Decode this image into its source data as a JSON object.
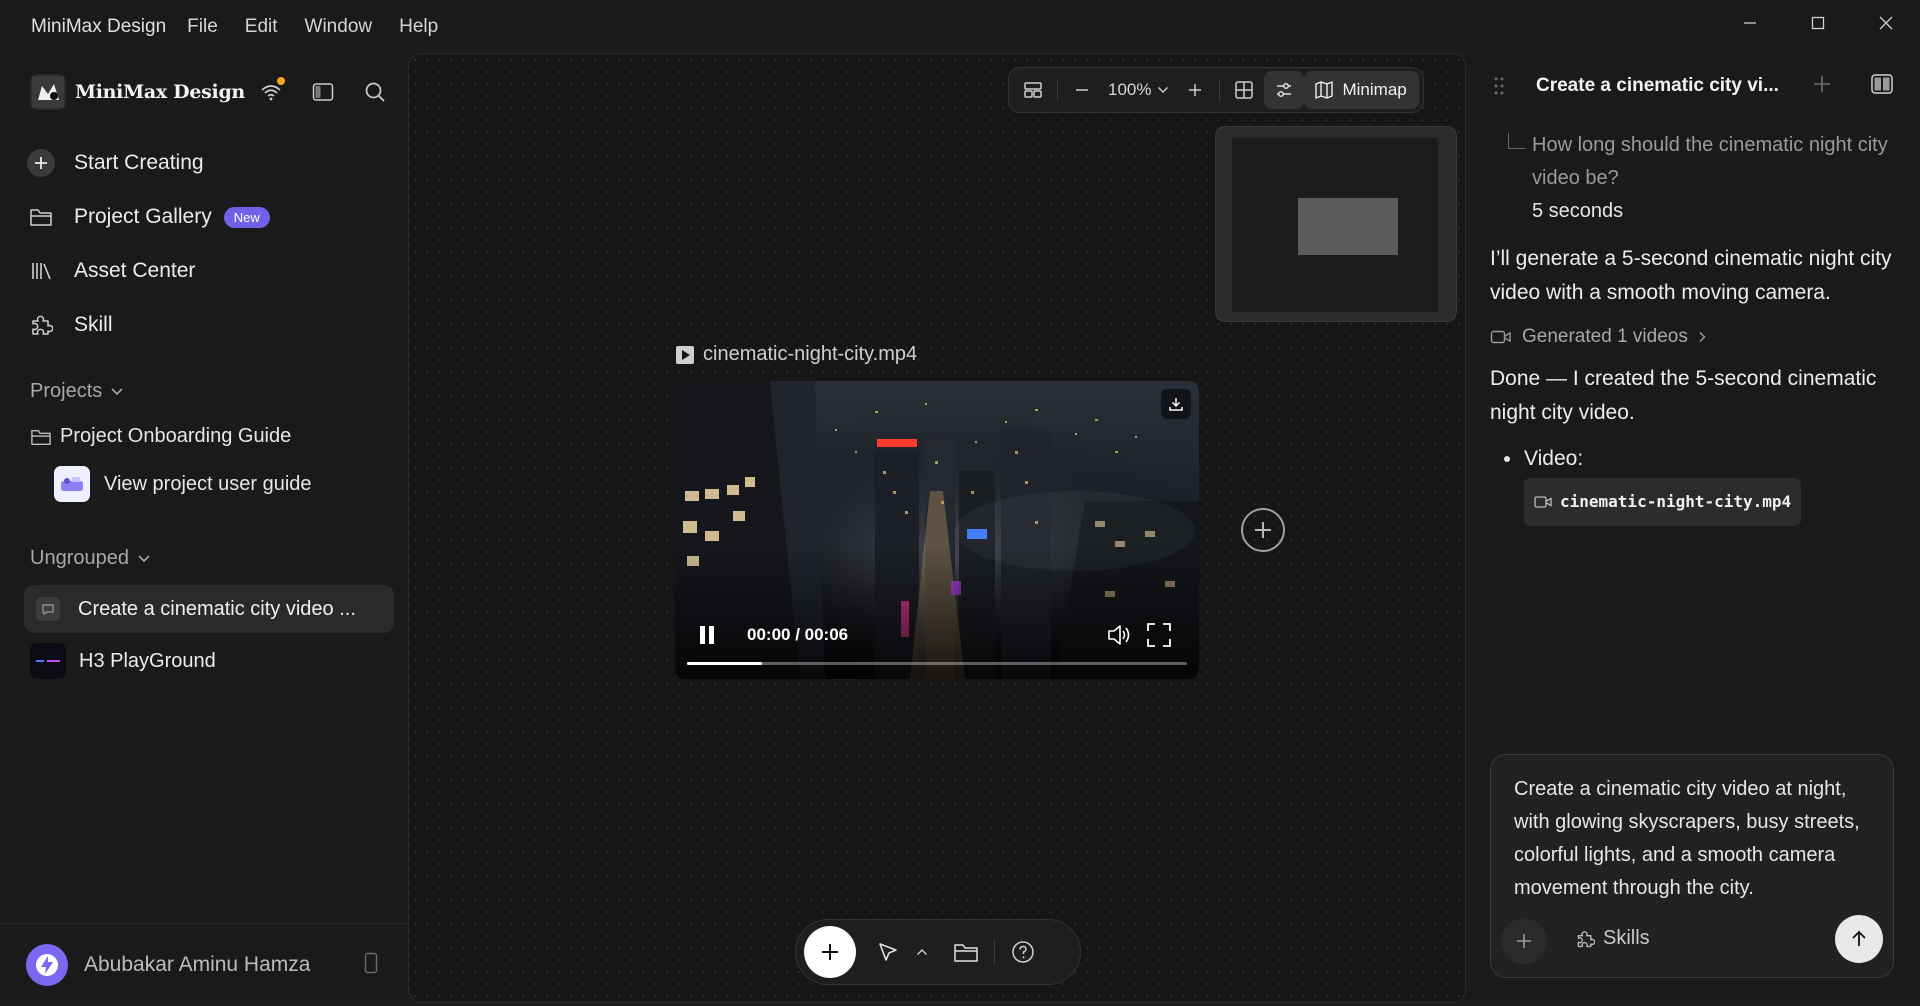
{
  "app": {
    "name": "MiniMax Design",
    "menu": [
      "File",
      "Edit",
      "Window",
      "Help"
    ]
  },
  "sidebar": {
    "brand": "MiniMax Design",
    "nav": [
      {
        "label": "Start Creating",
        "icon": "plus-circle-icon"
      },
      {
        "label": "Project Gallery",
        "icon": "folder-icon",
        "badge": "New"
      },
      {
        "label": "Asset Center",
        "icon": "library-icon"
      },
      {
        "label": "Skill",
        "icon": "puzzle-icon"
      }
    ],
    "projects_label": "Projects",
    "project_folder": "Project Onboarding Guide",
    "project_item": "View project user guide",
    "ungrouped_label": "Ungrouped",
    "chats": [
      {
        "label": "Create a cinematic city video ..."
      },
      {
        "label": "H3 PlayGround"
      }
    ],
    "user": "Abubakar Aminu Hamza",
    "colors": {
      "badge": "#6f62e8",
      "notification": "#f5a623",
      "avatar": "#7b68f0"
    }
  },
  "toolbar": {
    "zoom": "100%",
    "minimap_label": "Minimap"
  },
  "canvas": {
    "video_filename": "cinematic-night-city.mp4",
    "time": "00:00 / 00:06",
    "progress": 0.15
  },
  "panel": {
    "title": "Create a cinematic city vi...",
    "question": "How long should the cinematic night city video be?",
    "answer": "5 seconds",
    "message1": "I’ll generate a 5-second cinematic night city video with a smooth moving camera.",
    "generated": "Generated 1 videos",
    "message2": "Done — I created the 5-second cinematic night city video.",
    "video_label": "Video:",
    "video_file": "cinematic-night-city.mp4",
    "composer_text": "Create a cinematic city video at night, with glowing skyscrapers, busy streets, colorful lights, and a smooth camera movement through the city.",
    "skills_label": "Skills"
  }
}
